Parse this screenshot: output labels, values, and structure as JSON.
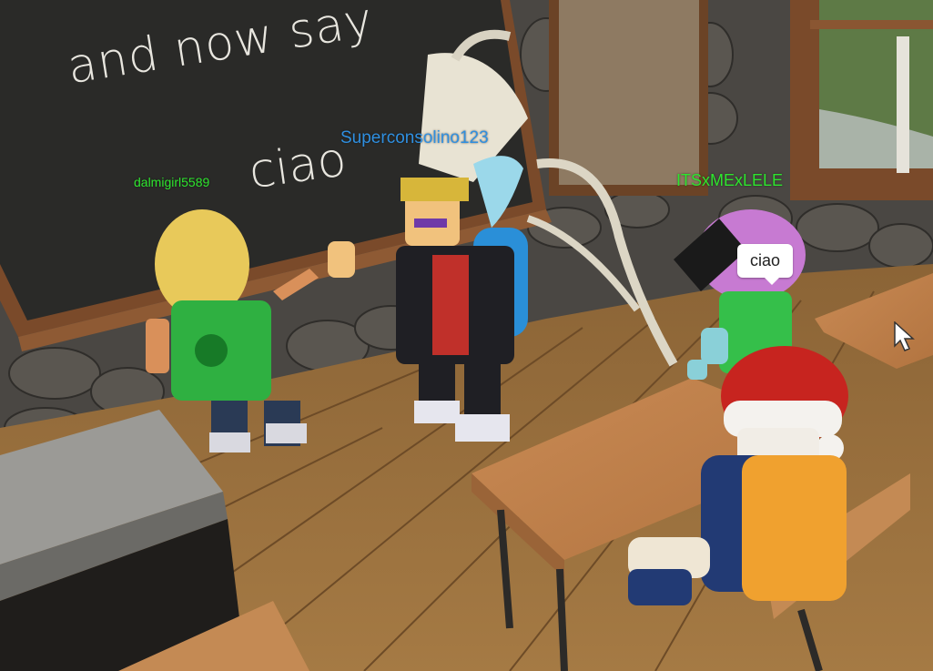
{
  "chalkboard": {
    "line1": "and now say",
    "line2": "ciao"
  },
  "players": [
    {
      "name": "dalmigirl5589",
      "color": "#2ee52e"
    },
    {
      "name": "Superconsolino123",
      "color": "#2f8fe0"
    },
    {
      "name": "ITSxMExLELE",
      "color": "#2ee52e"
    }
  ],
  "chat_bubble": {
    "text": "ciao",
    "speaker": "ITSxMExLELE"
  },
  "icons": {
    "cursor": "mouse-pointer-icon"
  }
}
